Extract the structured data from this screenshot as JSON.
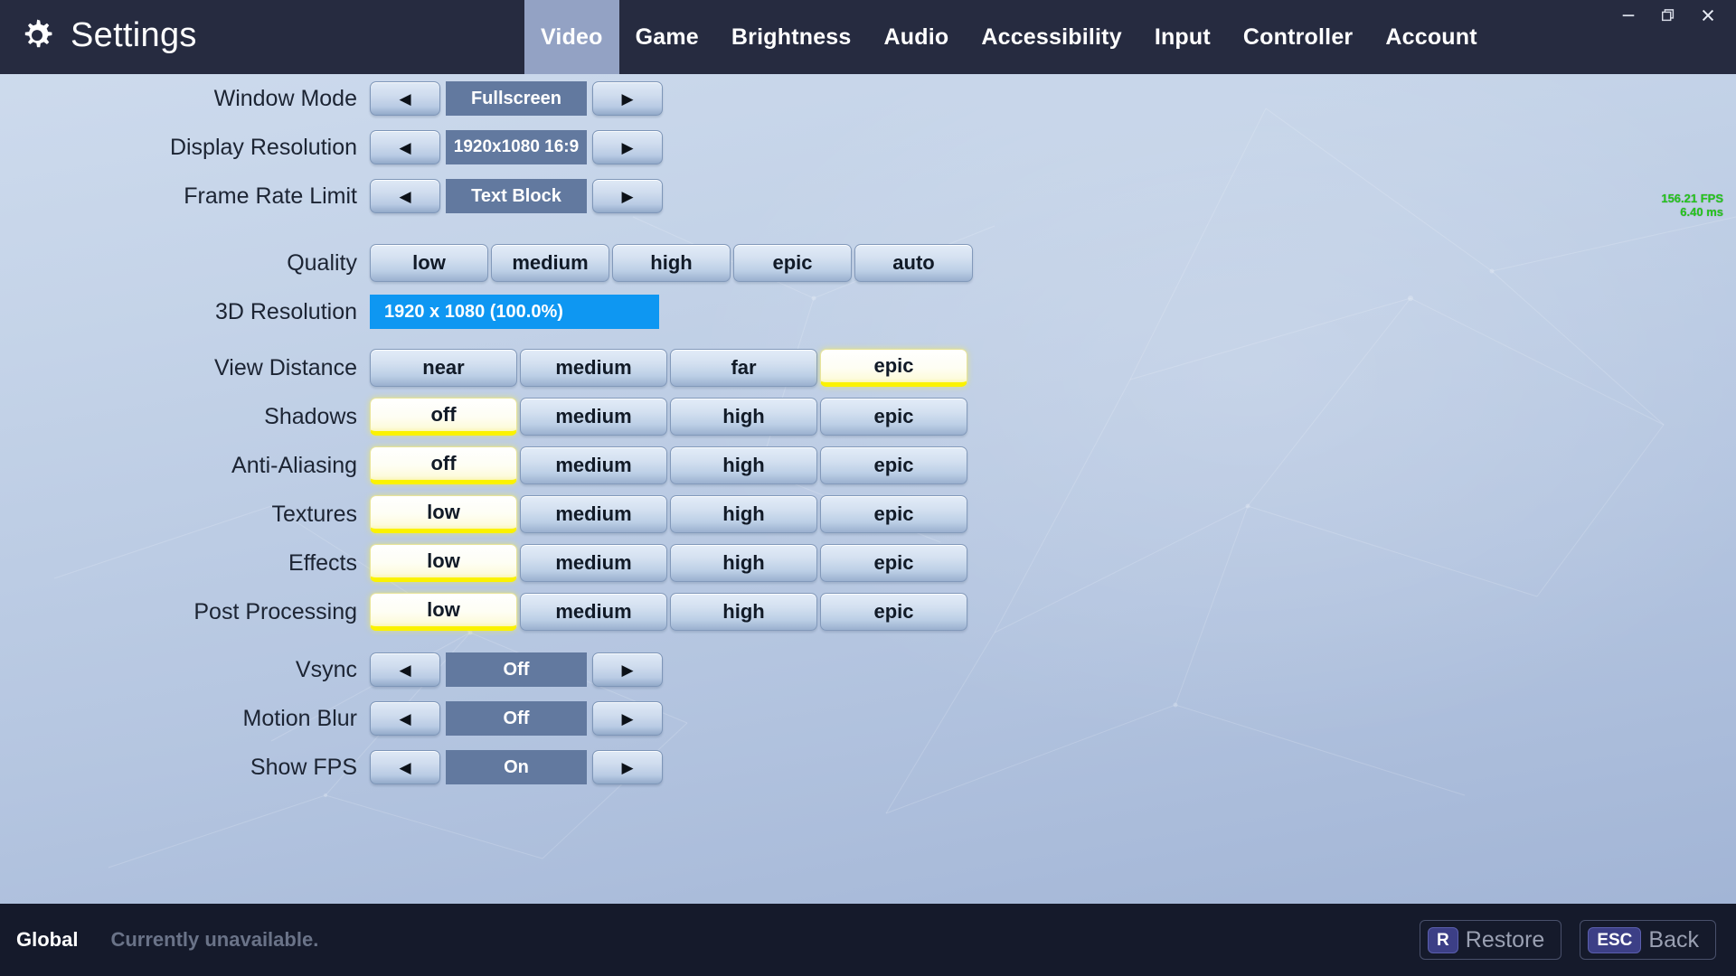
{
  "titlebar": {
    "app_title": "Settings",
    "gear_icon": "gear-icon",
    "tabs": [
      {
        "label": "Video",
        "active": true
      },
      {
        "label": "Game",
        "active": false
      },
      {
        "label": "Brightness",
        "active": false
      },
      {
        "label": "Audio",
        "active": false
      },
      {
        "label": "Accessibility",
        "active": false
      },
      {
        "label": "Input",
        "active": false
      },
      {
        "label": "Controller",
        "active": false
      },
      {
        "label": "Account",
        "active": false
      }
    ],
    "window_controls": [
      {
        "name": "minimize-icon"
      },
      {
        "name": "restore-icon"
      },
      {
        "name": "close-icon"
      }
    ]
  },
  "fps_overlay": {
    "fps": "156.21 FPS",
    "frametime": "6.40 ms",
    "color": "#23c61a"
  },
  "settings": {
    "spinner_rows": [
      {
        "label": "Window Mode",
        "value": "Fullscreen"
      },
      {
        "label": "Display Resolution",
        "value": "1920x1080 16:9"
      },
      {
        "label": "Frame Rate Limit",
        "value": "Text Block"
      }
    ],
    "quality_row": {
      "label": "Quality",
      "options": [
        "low",
        "medium",
        "high",
        "epic",
        "auto"
      ],
      "selected": null
    },
    "resolution_3d": {
      "label": "3D Resolution",
      "value": "1920 x 1080 (100.0%)",
      "percent": 100.0,
      "fill_color": "#0e97f2"
    },
    "option_rows": [
      {
        "label": "View Distance",
        "options": [
          "near",
          "medium",
          "far",
          "epic"
        ],
        "selected": "epic"
      },
      {
        "label": "Shadows",
        "options": [
          "off",
          "medium",
          "high",
          "epic"
        ],
        "selected": "off"
      },
      {
        "label": "Anti-Aliasing",
        "options": [
          "off",
          "medium",
          "high",
          "epic"
        ],
        "selected": "off"
      },
      {
        "label": "Textures",
        "options": [
          "low",
          "medium",
          "high",
          "epic"
        ],
        "selected": "low"
      },
      {
        "label": "Effects",
        "options": [
          "low",
          "medium",
          "high",
          "epic"
        ],
        "selected": "low"
      },
      {
        "label": "Post Processing",
        "options": [
          "low",
          "medium",
          "high",
          "epic"
        ],
        "selected": "low"
      }
    ],
    "toggle_rows": [
      {
        "label": "Vsync",
        "value": "Off"
      },
      {
        "label": "Motion Blur",
        "value": "Off"
      },
      {
        "label": "Show FPS",
        "value": "On"
      }
    ],
    "arrow_left": "◀",
    "arrow_right": "▶"
  },
  "bottombar": {
    "scope": "Global",
    "status": "Currently unavailable.",
    "actions": [
      {
        "key": "R",
        "label": "Restore"
      },
      {
        "key": "ESC",
        "label": "Back"
      }
    ]
  },
  "theme": {
    "titlebar_bg": "#262b40",
    "bottombar_bg": "#151a2b",
    "active_tab_bg": "#93a2c4",
    "value_box_bg": "#62799f",
    "selection_yellow": "#fbf200",
    "slider_blue": "#0e97f2"
  }
}
